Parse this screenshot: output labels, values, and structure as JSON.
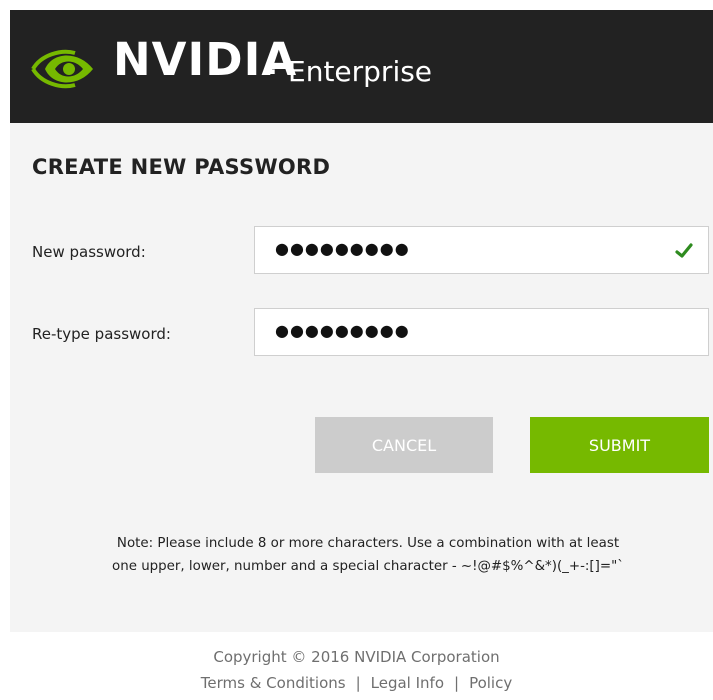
{
  "header": {
    "brand": "NVIDIA",
    "brand_suffix": ".",
    "product": "Enterprise",
    "logo_icon": "nvidia-eye-logo",
    "background_color": "#222222",
    "accent_color": "#76b900"
  },
  "form": {
    "title": "CREATE NEW PASSWORD",
    "new_password": {
      "label": "New password:",
      "value": "●●●●●●●●●",
      "valid_icon": "check-icon",
      "valid": true
    },
    "retype_password": {
      "label": "Re-type password:",
      "value": "●●●●●●●●●"
    },
    "cancel_label": "CANCEL",
    "submit_label": "SUBMIT",
    "note_line1": "Note: Please include 8 or more characters. Use a combination with at least",
    "note_line2": "one upper, lower, number and a special character - ~!@#$%^&*)(_+-:[]=\"`"
  },
  "footer": {
    "copyright": "Copyright © 2016 NVIDIA Corporation",
    "links": [
      "Terms & Conditions",
      "Legal Info",
      "Policy"
    ],
    "separator": "|"
  }
}
